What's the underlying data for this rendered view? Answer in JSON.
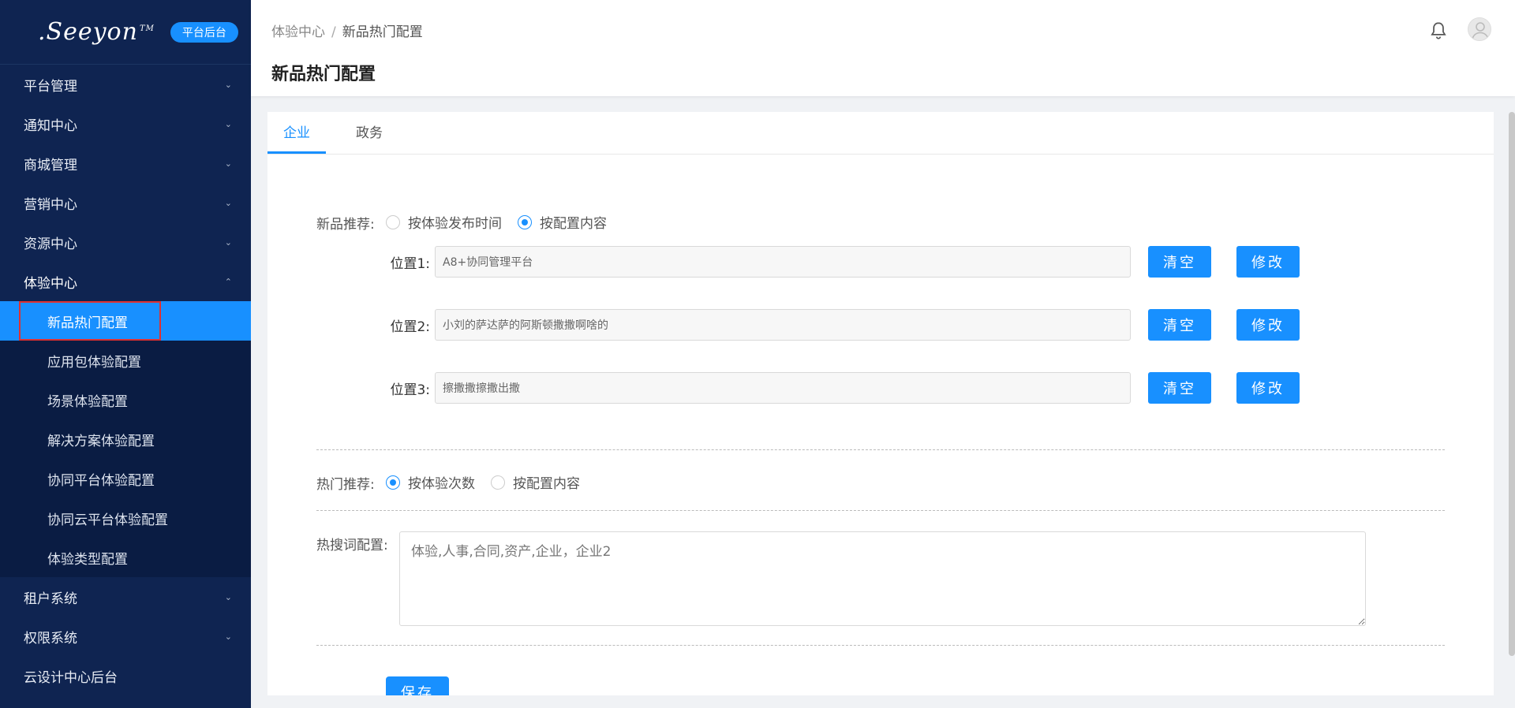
{
  "brand": {
    "logo_text": ".Seeyon",
    "logo_tm": "TM",
    "badge": "平台后台"
  },
  "sidebar": {
    "items": [
      {
        "label": "平台管理",
        "chevron": "chevron-down-icon"
      },
      {
        "label": "通知中心",
        "chevron": "chevron-down-icon"
      },
      {
        "label": "商城管理",
        "chevron": "chevron-down-icon"
      },
      {
        "label": "营销中心",
        "chevron": "chevron-down-icon"
      },
      {
        "label": "资源中心",
        "chevron": "chevron-down-icon"
      },
      {
        "label": "体验中心",
        "chevron": "chevron-up-icon"
      },
      {
        "label": "租户系统",
        "chevron": "chevron-down-icon"
      },
      {
        "label": "权限系统",
        "chevron": "chevron-down-icon"
      },
      {
        "label": "云设计中心后台"
      }
    ],
    "sub_items": [
      {
        "label": "新品热门配置"
      },
      {
        "label": "应用包体验配置"
      },
      {
        "label": "场景体验配置"
      },
      {
        "label": "解决方案体验配置"
      },
      {
        "label": "协同平台体验配置"
      },
      {
        "label": "协同云平台体验配置"
      },
      {
        "label": "体验类型配置"
      }
    ]
  },
  "header": {
    "breadcrumb": [
      "体验中心",
      "新品热门配置"
    ],
    "separator": "/",
    "title": "新品热门配置"
  },
  "tabs": [
    {
      "label": "企业"
    },
    {
      "label": "政务"
    }
  ],
  "new_product": {
    "label": "新品推荐:",
    "options": [
      {
        "label": "按体验发布时间"
      },
      {
        "label": "按配置内容"
      }
    ],
    "positions": [
      {
        "label": "位置1:",
        "value": "A8+协同管理平台"
      },
      {
        "label": "位置2:",
        "value": "小刘的萨达萨的阿斯顿撒撒啊啥的"
      },
      {
        "label": "位置3:",
        "value": "擦撒撒擦撒出撒"
      }
    ],
    "clear_label": "清空",
    "edit_label": "修改"
  },
  "hot": {
    "label": "热门推荐:",
    "options": [
      {
        "label": "按体验次数"
      },
      {
        "label": "按配置内容"
      }
    ]
  },
  "hotwords": {
    "label": "热搜词配置:",
    "value": "体验,人事,合同,资产,企业，企业2"
  },
  "save_label": "保存",
  "colors": {
    "sidebar_bg": "#0f2451",
    "accent": "#1890ff",
    "highlight_border": "#e03030"
  }
}
